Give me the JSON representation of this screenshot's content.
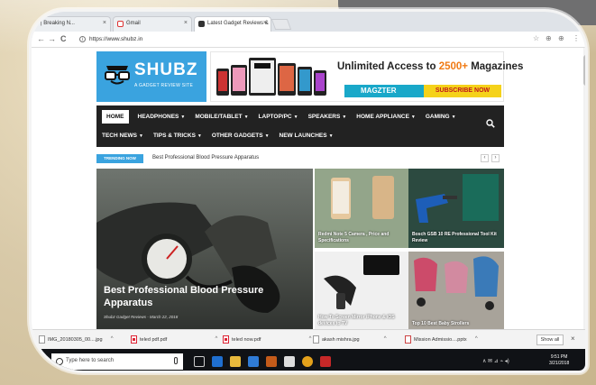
{
  "browser": {
    "tabs": [
      {
        "label": "e | Breaking N...",
        "close": "×"
      },
      {
        "label": "Gmail",
        "close": "×"
      },
      {
        "label": "Latest Gadget Reviews &",
        "close": "×"
      }
    ],
    "url": "https://www.shubz.in",
    "lock": "i",
    "nav": {
      "back": "←",
      "forward": "→",
      "reload": "C"
    },
    "tools": {
      "star": "☆",
      "ext": "⊕",
      "menu": "⋮"
    }
  },
  "site": {
    "logo": {
      "name": "SHUBZ",
      "tagline": "A GADGET REVIEW SITE"
    },
    "banner": {
      "headline_pre": "Unlimited Access to ",
      "headline_highlight": "2500+",
      "headline_post": " Magazines",
      "brand": "MAGZTER",
      "cta": "SUBSCRIBE NOW"
    },
    "nav_row1": [
      {
        "label": "HOME",
        "caret": ""
      },
      {
        "label": "HEADPHONES",
        "caret": "▼"
      },
      {
        "label": "MOBILE/TABLET",
        "caret": "▼"
      },
      {
        "label": "LAPTOP/PC",
        "caret": "▼"
      },
      {
        "label": "SPEAKERS",
        "caret": "▼"
      },
      {
        "label": "HOME APPLIANCE",
        "caret": "▼"
      },
      {
        "label": "GAMING",
        "caret": "▼"
      }
    ],
    "nav_row2": [
      {
        "label": "TECH NEWS",
        "caret": "▼"
      },
      {
        "label": "TIPS & TRICKS",
        "caret": "▼"
      },
      {
        "label": "OTHER GADGETS",
        "caret": "▼"
      },
      {
        "label": "NEW LAUNCHES",
        "caret": "▼"
      }
    ],
    "trending": {
      "badge": "TRENDING NOW",
      "text": "Best Professional Blood Pressure Apparatus",
      "prev": "‹",
      "next": "›"
    },
    "featured": {
      "title": "Best Professional Blood Pressure Apparatus",
      "meta": "Shubz Gadget Reviews - March 22, 2018"
    },
    "tiles": [
      {
        "title": "Redmi Note 5 Camera , Price and Specifications"
      },
      {
        "title": "Bosch GSB 10 RE Professional Tool Kit Review"
      },
      {
        "title": "How To Screen Mirror iPhone & iOS devices to TV"
      },
      {
        "title": "Top 10 Best Baby Strollers"
      }
    ]
  },
  "downloads": {
    "items": [
      {
        "label": "IMG_20180305_00....jpg",
        "type": "img"
      },
      {
        "label": "teled pdf.pdf",
        "type": "pdf"
      },
      {
        "label": "teled now.pdf",
        "type": "pdf"
      },
      {
        "label": "akash mishra.jpg",
        "type": "img"
      },
      {
        "label": "Mission Admissio....pptx",
        "type": "pptx"
      }
    ],
    "caret": "^",
    "show_all": "Show all",
    "close": "×"
  },
  "taskbar": {
    "search_placeholder": "Type here to search",
    "tray": "∧  ✉  ⊿  ⌁  ◂)",
    "time": "9:51 PM",
    "date": "3/21/2018"
  }
}
